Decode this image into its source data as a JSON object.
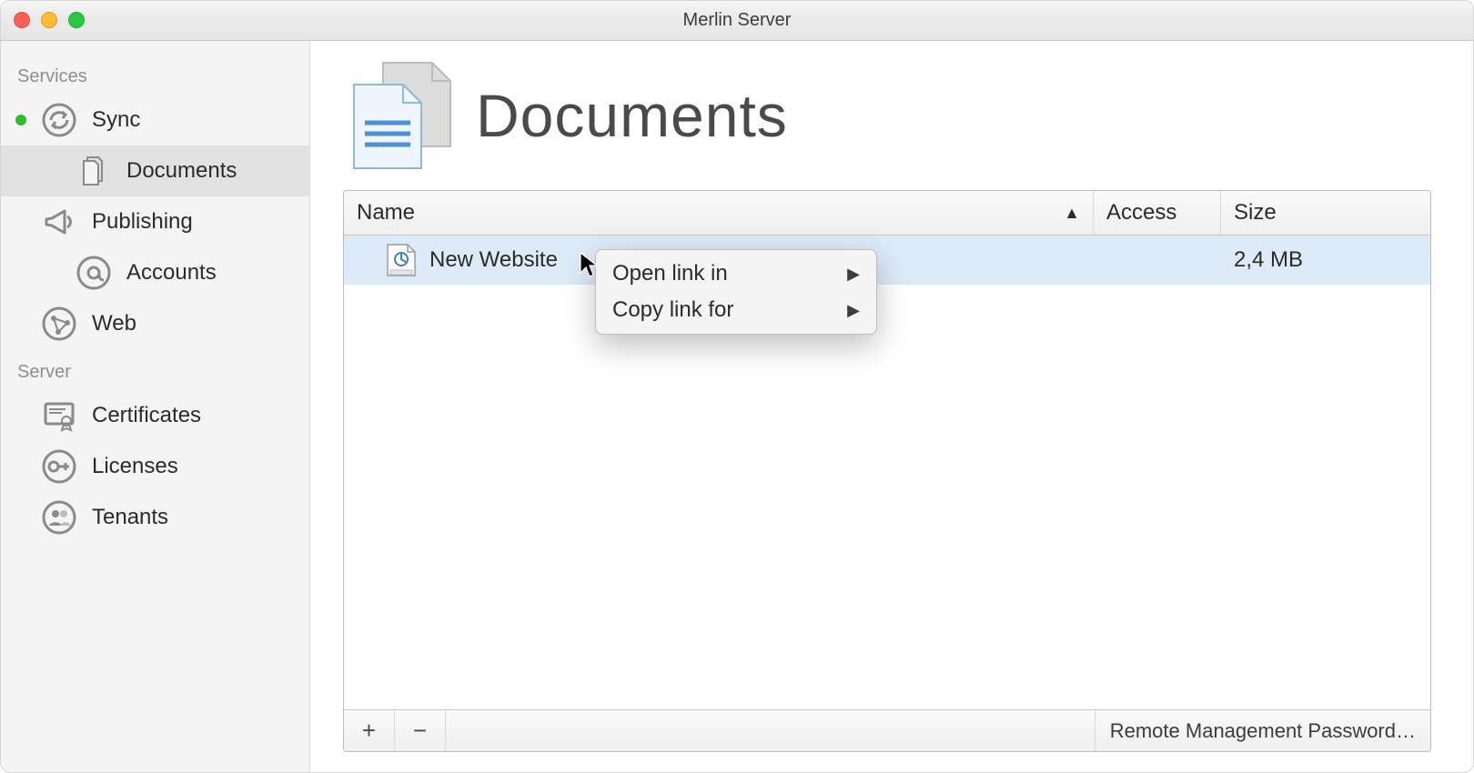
{
  "window_title": "Merlin Server",
  "sidebar": {
    "sections": [
      {
        "label": "Services",
        "items": [
          {
            "name": "sync",
            "label": "Sync",
            "status": "green",
            "indent": false
          },
          {
            "name": "documents",
            "label": "Documents",
            "indent": true,
            "selected": true
          },
          {
            "name": "publishing",
            "label": "Publishing",
            "indent": false
          },
          {
            "name": "accounts",
            "label": "Accounts",
            "indent": true
          },
          {
            "name": "web",
            "label": "Web",
            "indent": false
          }
        ]
      },
      {
        "label": "Server",
        "items": [
          {
            "name": "certificates",
            "label": "Certificates"
          },
          {
            "name": "licenses",
            "label": "Licenses"
          },
          {
            "name": "tenants",
            "label": "Tenants"
          }
        ]
      }
    ]
  },
  "page": {
    "title": "Documents"
  },
  "table": {
    "columns": {
      "name": "Name",
      "access": "Access",
      "size": "Size"
    },
    "sort_column": "name",
    "sort_direction": "asc",
    "rows": [
      {
        "name": "New Website",
        "access": "",
        "size": "2,4 MB",
        "selected": true
      }
    ]
  },
  "footer": {
    "add_label": "+",
    "remove_label": "−",
    "password_button": "Remote Management Password…"
  },
  "context_menu": {
    "items": [
      {
        "label": "Open link in",
        "submenu": true
      },
      {
        "label": "Copy link for",
        "submenu": true
      }
    ]
  }
}
